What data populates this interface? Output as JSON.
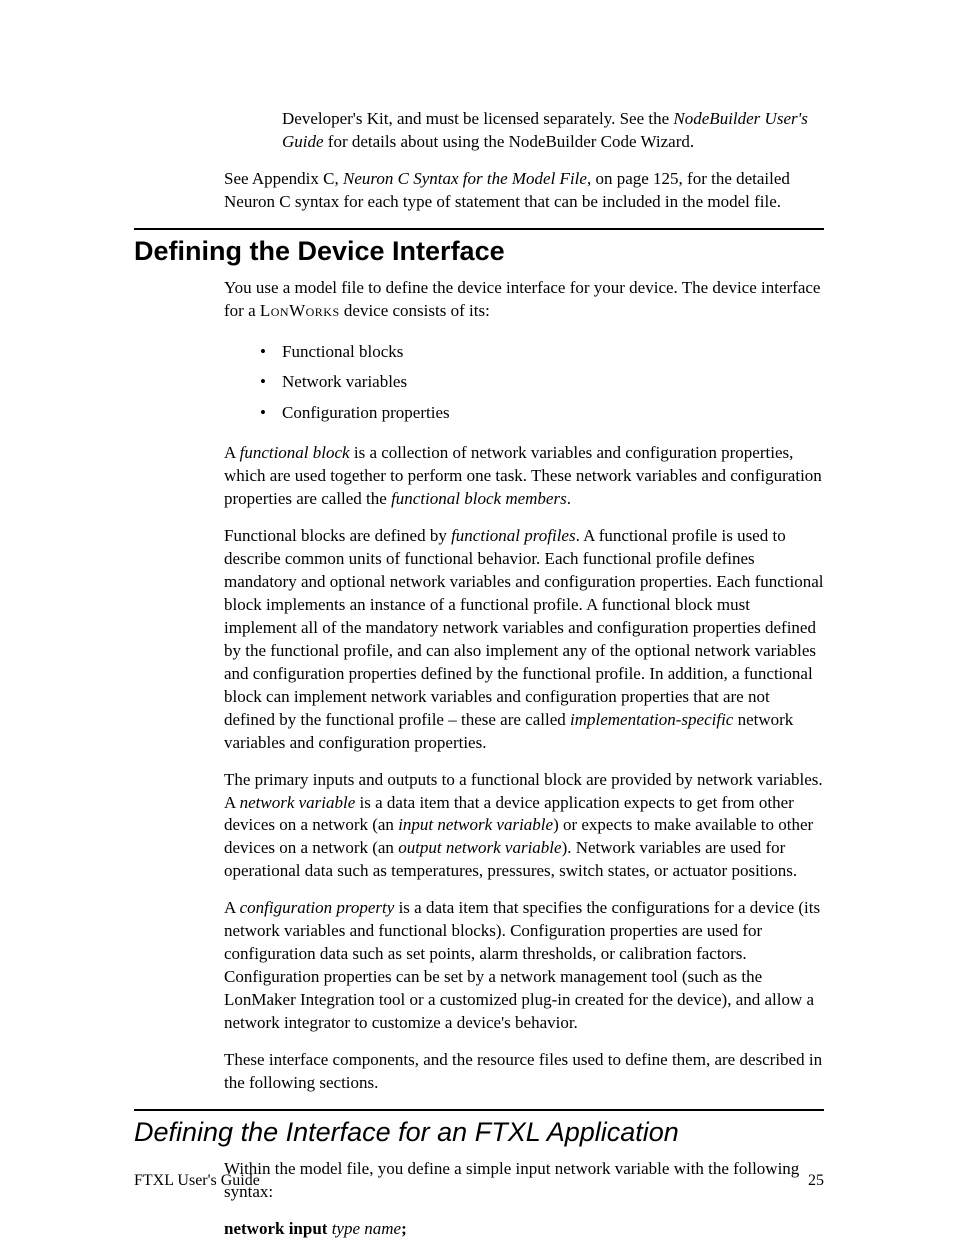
{
  "intro": {
    "p1a": "Developer's Kit, and must be licensed separately.  See the ",
    "p1i": "NodeBuilder User's Guide",
    "p1b": " for details about using the NodeBuilder Code Wizard.",
    "p2a": "See Appendix C, ",
    "p2i": "Neuron C Syntax for the Model File",
    "p2b": ", on page 125, for the detailed Neuron C syntax for each type of statement that can be included in the model file."
  },
  "sec1": {
    "title": "Defining the Device Interface",
    "p1a": "You use a model file to define the device interface for your device.  The device interface for a ",
    "p1sc": "LonWorks",
    "p1b": " device consists of its:",
    "bullets": [
      "Functional blocks",
      "Network variables",
      "Configuration properties"
    ],
    "p2a": "A ",
    "p2i1": "functional block",
    "p2b": " is a collection of network variables and configuration properties, which are used together to perform one task.  These network variables and configuration properties are called the ",
    "p2i2": "functional block members",
    "p2c": ".",
    "p3a": "Functional blocks are defined by ",
    "p3i1": "functional profiles",
    "p3b": ".  A functional profile is used to describe common units of functional behavior.  Each functional profile defines mandatory and optional network variables and configuration properties.  Each functional block implements an instance of a functional profile.  A functional block must implement all of the mandatory network variables and configuration properties defined by the functional profile, and can also implement any of the optional network variables and configuration properties defined by the functional profile.  In addition, a functional block can implement network variables and configuration properties that are not defined by the functional profile – these are called ",
    "p3i2": "implementation-specific",
    "p3c": " network variables and configuration properties.",
    "p4a": "The primary inputs and outputs to a functional block are provided by network variables.  A ",
    "p4i1": "network variable",
    "p4b": " is a data item that a device application expects to get from other devices on a network (an ",
    "p4i2": "input network variable",
    "p4c": ") or expects to make available to other devices on a network (an ",
    "p4i3": "output network variable",
    "p4d": ").  Network variables are used for operational data such as temperatures, pressures, switch states, or actuator positions.",
    "p5a": "A ",
    "p5i1": "configuration property",
    "p5b": " is a data item that specifies the configurations for a device (its network variables and functional blocks).  Configuration properties are used for configuration data such as set points, alarm thresholds, or calibration factors.  Configuration properties can be set by a network management tool (such as the LonMaker Integration tool or a customized plug-in created for the device), and allow a network integrator to customize a device's behavior.",
    "p6": "These interface components, and the resource files used to define them, are described in the following sections."
  },
  "sec2": {
    "title": "Defining the Interface for an FTXL Application",
    "p1": "Within the model file, you define a simple input network variable with the following syntax:",
    "syntax_bold": "network input ",
    "syntax_ital": "type name",
    "syntax_end": ";"
  },
  "footer": {
    "left": "FTXL User's Guide",
    "right": "25"
  }
}
